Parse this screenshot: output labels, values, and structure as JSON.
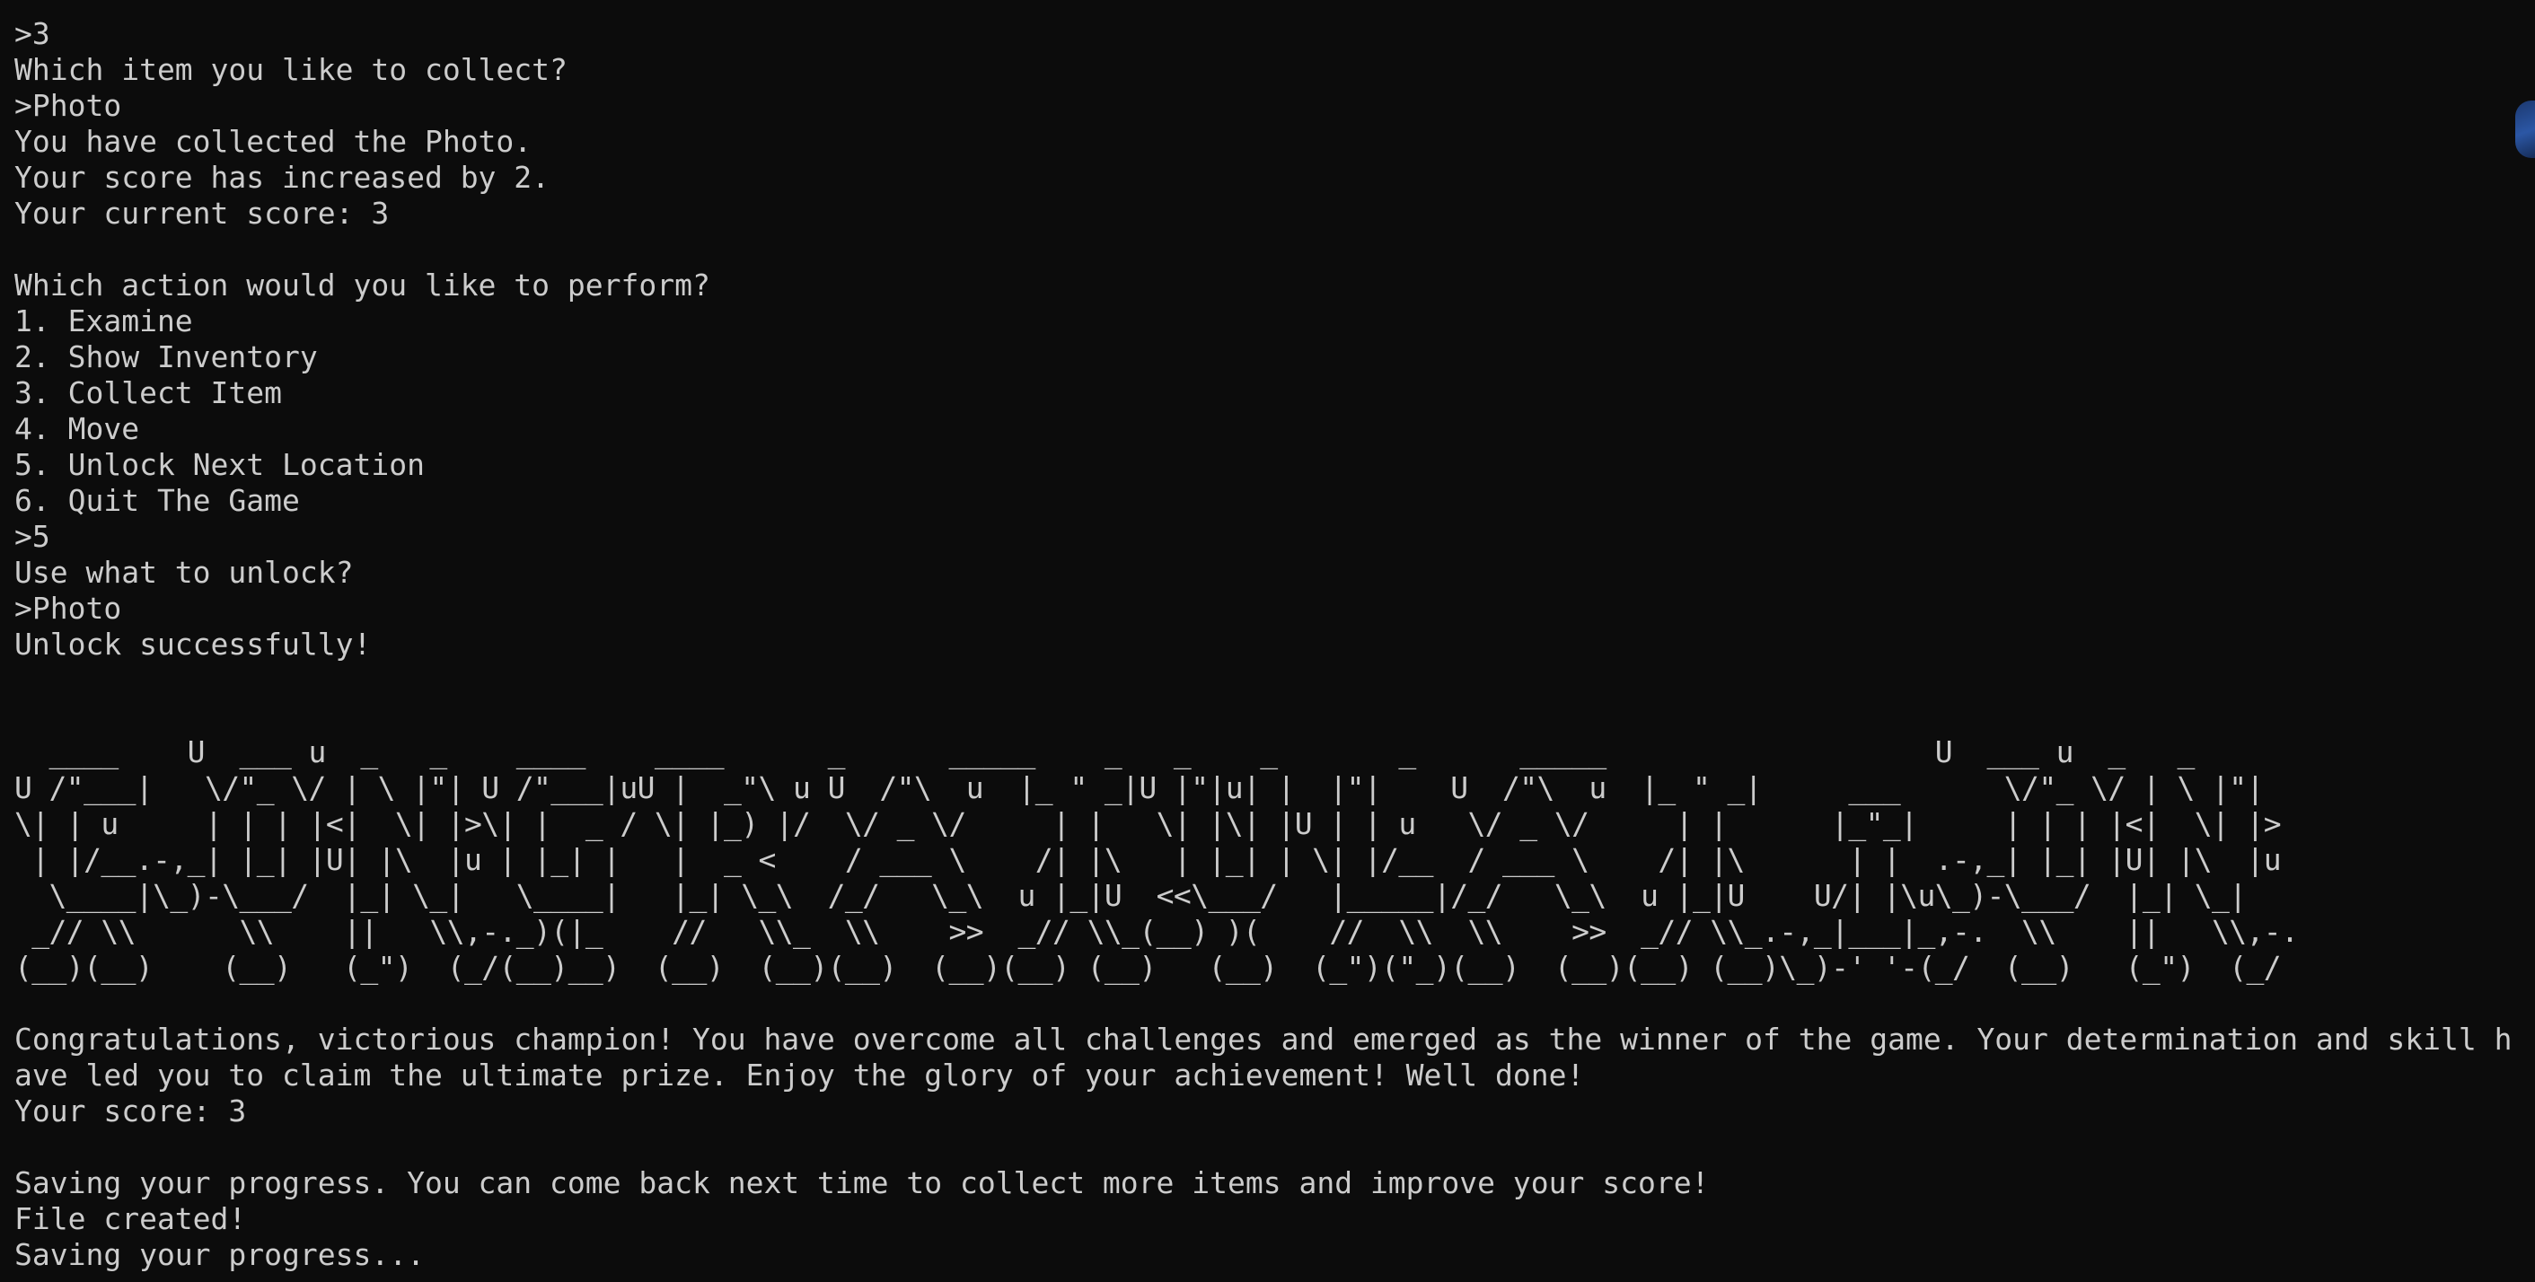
{
  "terminal": {
    "lines": [
      ">3",
      "Which item you like to collect?",
      ">Photo",
      "You have collected the Photo.",
      "Your score has increased by 2.",
      "Your current score: 3",
      "",
      "Which action would you like to perform?",
      "1. Examine",
      "2. Show Inventory",
      "3. Collect Item",
      "4. Move",
      "5. Unlock Next Location",
      "6. Quit The Game",
      ">5",
      "Use what to unlock?",
      ">Photo",
      "Unlock successfully!",
      "",
      ""
    ],
    "ascii_art": [
      "  ____    U  ___ u  _   _    ____    ____      _      _____    _   _    _       _      _____                   U  ___ u  _   _",
      "U /\"___|   \\/\"_ \\/ | \\ |\"| U /\"___|uU |  _\"\\ u U  /\"\\  u  |_ \" _|U |\"|u| |  |\"|    U  /\"\\  u  |_ \" _|     ___      \\/\"_ \\/ | \\ |\"|",
      "\\| | u     | | | |<|  \\| |>\\| |  _ / \\| |_) |/  \\/ _ \\/     | |   \\| |\\| |U | | u   \\/ _ \\/     | |      |_\"_|     | | | |<|  \\| |>",
      " | |/__.-,_| |_| |U| |\\  |u | |_| |   |  _ <    / ___ \\    /| |\\   | |_| | \\| |/__  / ___ \\    /| |\\      | |  .-,_| |_| |U| |\\  |u",
      "  \\____|\\_)-\\___/  |_| \\_|   \\____|   |_| \\_\\  /_/   \\_\\  u |_|U  <<\\___/   |_____|/_/   \\_\\  u |_|U    U/| |\\u\\_)-\\___/  |_| \\_|",
      " _// \\\\      \\\\    ||   \\\\,-._)(|_    //   \\\\_  \\\\    >>  _// \\\\_(__) )(    //  \\\\  \\\\    >>  _// \\\\_.-,_|___|_,-.  \\\\    ||   \\\\,-.",
      "(__)(__)    (__)   (_\")  (_/(__)__)  (__)  (__)(__)  (__)(__) (__)   (__)  (_\")(\"_)(__)  (__)(__) (__)\\_)-' '-(_/  (__)   (_\")  (_/"
    ],
    "after_lines": [
      "",
      "Congratulations, victorious champion! You have overcome all challenges and emerged as the winner of the game. Your determination and skill h",
      "ave led you to claim the ultimate prize. Enjoy the glory of your achievement! Well done!",
      "Your score: 3",
      "",
      "Saving your progress. You can come back next time to collect more items and improve your score!",
      "File created!",
      "Saving your progress..."
    ]
  },
  "colors": {
    "background": "#0c0c0c",
    "foreground": "#cccccc",
    "accent": "#2f5fb6"
  }
}
